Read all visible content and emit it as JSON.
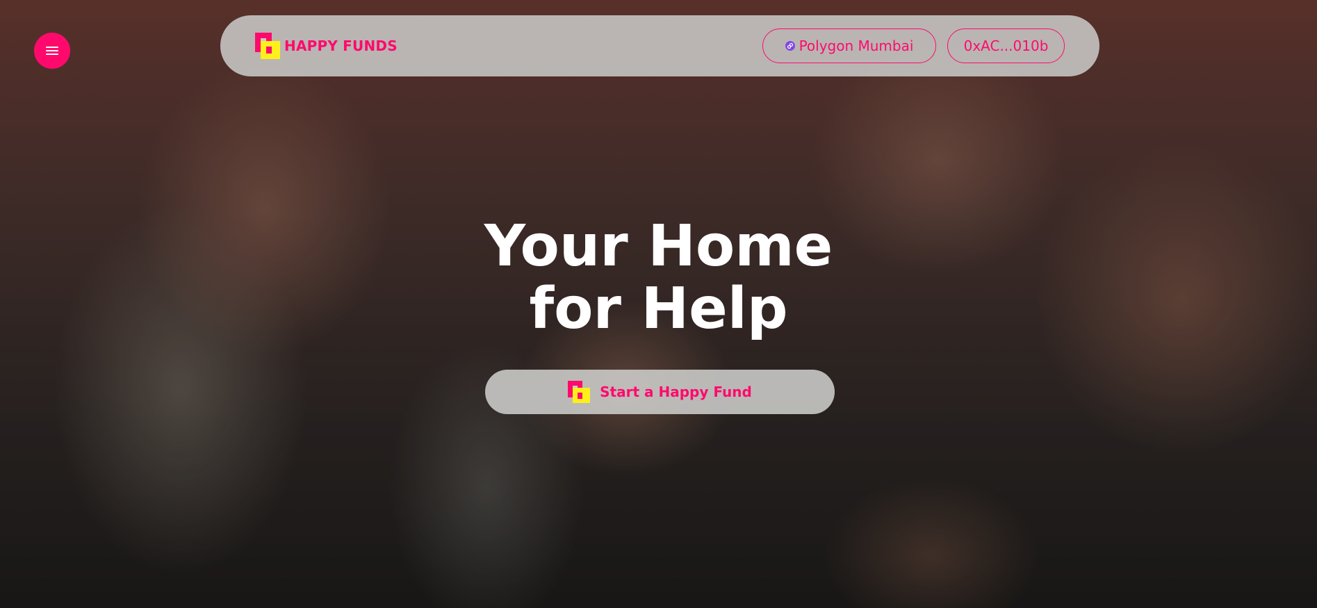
{
  "header": {
    "brand_name": "HAPPY FUNDS",
    "network_label": "Polygon Mumbai",
    "wallet_label": "0xAC...010b"
  },
  "hero": {
    "title_line1": "Your Home",
    "title_line2": "for Help",
    "cta_label": "Start a Happy Fund"
  },
  "icons": {
    "menu": "hamburger-menu-icon",
    "network": "polygon-chain-icon",
    "logo": "happy-funds-logo"
  },
  "colors": {
    "accent": "#ff0a6c",
    "logo_yellow": "#ffef1a",
    "network_purple": "#8247e5",
    "hero_text": "#ffffff"
  }
}
